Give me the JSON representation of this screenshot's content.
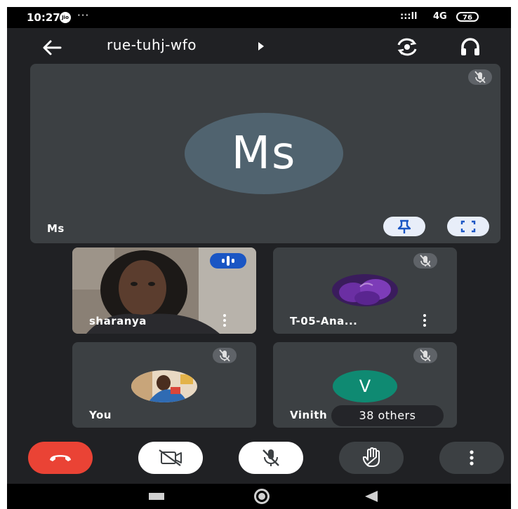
{
  "status_bar": {
    "time": "10:27",
    "carrier_badge": "Jio",
    "overflow_dots": "···",
    "signal": ":::ll",
    "network": "4G",
    "battery": "76"
  },
  "header": {
    "meeting_code": "rue-tuhj-wfo"
  },
  "main_tile": {
    "initials": "Ms",
    "name": "Ms"
  },
  "tiles": [
    {
      "name": "sharanya"
    },
    {
      "name": "T-05-Ana..."
    },
    {
      "name": "You"
    },
    {
      "name": "Vinith",
      "initial": "V"
    }
  ],
  "others_chip": "38 others",
  "colors": {
    "background": "#202124",
    "tile": "#3c4043",
    "end_call": "#ea4335",
    "control_light": "#ffffff",
    "control_dark": "#3c4043",
    "main_avatar": "#50636f",
    "vinith_avatar": "#0f8a72",
    "speaking_badge": "#1a56c4"
  },
  "icons": {
    "back": "arrow-left-icon",
    "flip": "flip-camera-icon",
    "audio": "headphones-icon",
    "mic_off": "mic-off-icon",
    "pin": "pin-icon",
    "fullscreen": "fullscreen-icon",
    "speaking": "audio-level-icon",
    "more": "more-vert-icon",
    "end_call": "call-end-icon",
    "camera_off": "videocam-off-icon",
    "raise_hand": "raise-hand-icon"
  }
}
